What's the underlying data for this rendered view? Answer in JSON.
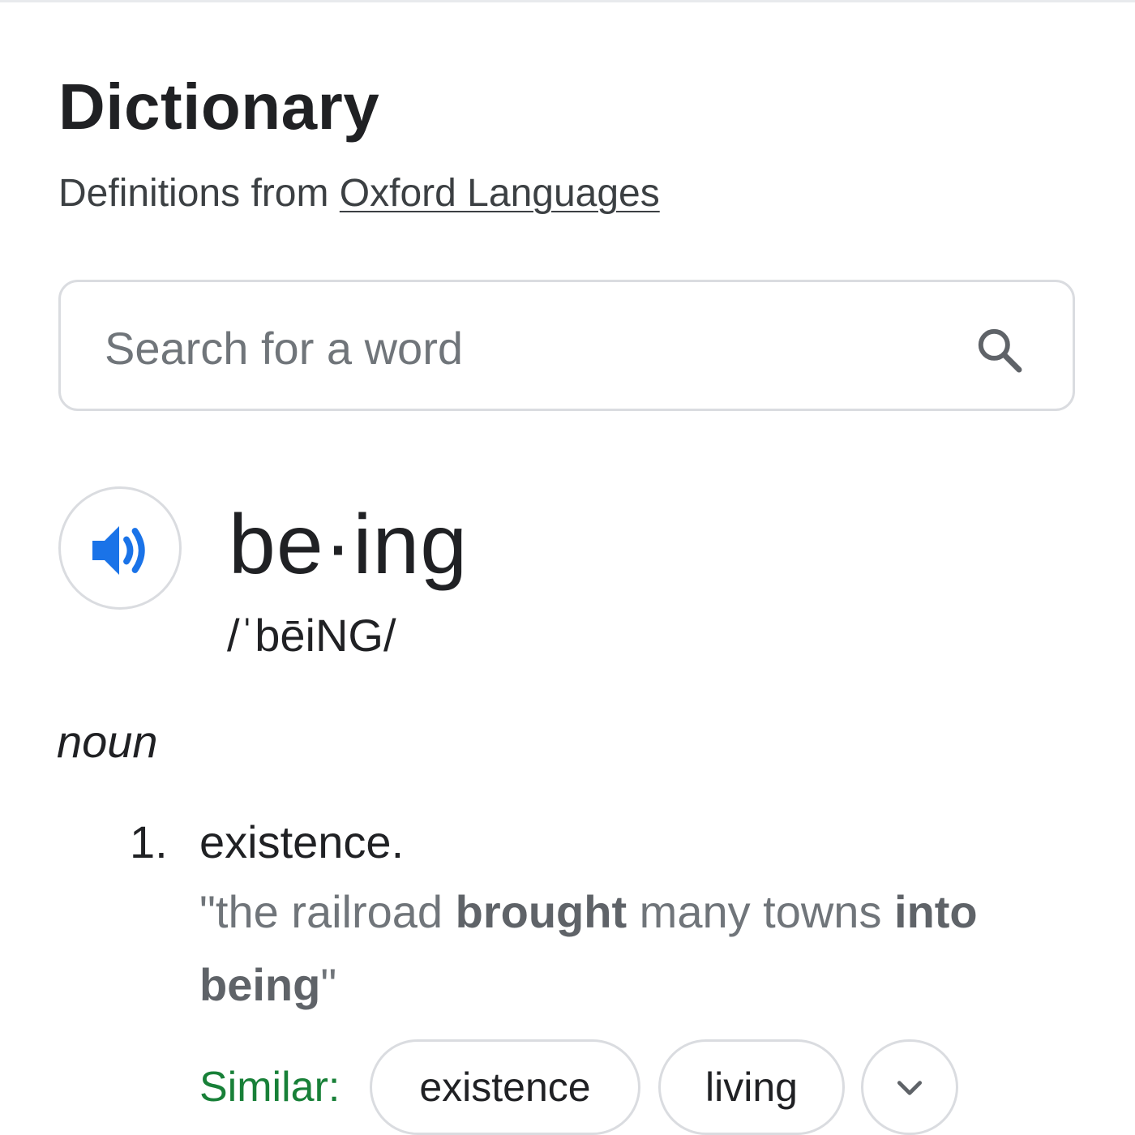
{
  "header": {
    "title": "Dictionary",
    "source_prefix": "Definitions from",
    "source_link": "Oxford Languages"
  },
  "search": {
    "placeholder": "Search for a word",
    "value": "",
    "icon": "search-icon"
  },
  "entry": {
    "audio_icon": "speaker-icon",
    "headword": "be·ing",
    "phonetic": "/ˈbēiNG/",
    "part_of_speech": "noun",
    "definitions": [
      {
        "number": "1.",
        "text": "existence.",
        "example": {
          "open_quote": "\"",
          "t1": "the railroad ",
          "b1": "brought",
          "t2": " many towns ",
          "b2": "into",
          "t3": " ",
          "b3": "being",
          "close_quote": "\""
        }
      }
    ],
    "similar": {
      "label": "Similar:",
      "words": [
        "existence",
        "living"
      ],
      "more_icon": "chevron-down-icon"
    }
  },
  "colors": {
    "similar_label": "#188038",
    "audio_icon": "#1a73e8",
    "border": "#dadce0"
  }
}
